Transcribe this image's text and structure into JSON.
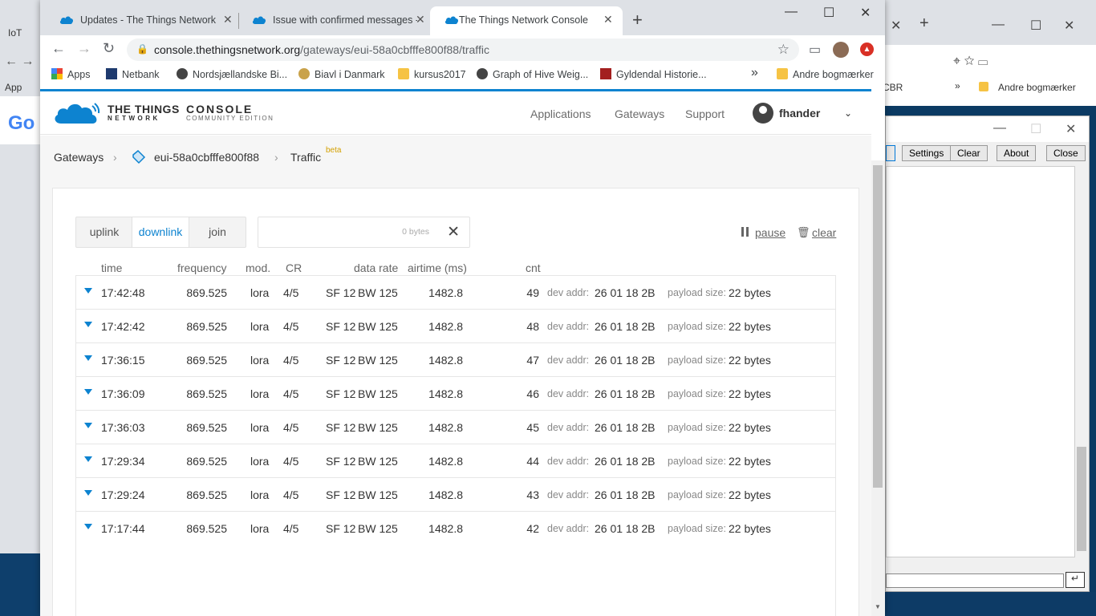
{
  "background": {
    "left_tab": "IoT",
    "left_apps": "App",
    "right_bookmark": "Andre bogmærker",
    "right_partial": "CBR",
    "debug_buttons": [
      "Settings",
      "Clear",
      "About",
      "Close"
    ]
  },
  "browser": {
    "tabs": [
      {
        "title": "Updates - The Things Network",
        "active": false
      },
      {
        "title": "Issue with confirmed messages -",
        "active": false
      },
      {
        "title": "The Things Network Console",
        "active": true
      }
    ],
    "url_host": "console.thethingsnetwork.org",
    "url_path": "/gateways/eui-58a0cbfffe800f88/traffic",
    "bookmarks": [
      "Apps",
      "Netbank",
      "Nordsjællandske Bi...",
      "Biavl i Danmark",
      "kursus2017",
      "Graph of Hive Weig...",
      "Gyldendal Historie..."
    ],
    "other_bookmarks": "Andre bogmærker"
  },
  "header": {
    "logo_line1": "THE THINGS",
    "logo_line2": "NETWORK",
    "console_line1": "CONSOLE",
    "console_line2": "COMMUNITY EDITION",
    "nav": [
      "Applications",
      "Gateways",
      "Support"
    ],
    "user": "fhander"
  },
  "breadcrumb": {
    "root": "Gateways",
    "gateway": "eui-58a0cbfffe800f88",
    "page": "Traffic",
    "badge": "beta"
  },
  "controls": {
    "tabs": [
      "uplink",
      "downlink",
      "join"
    ],
    "active_tab": "downlink",
    "filter_bytes": "0 bytes",
    "pause": "pause",
    "clear": "clear"
  },
  "table": {
    "columns": [
      "time",
      "frequency",
      "mod.",
      "CR",
      "data rate",
      "airtime (ms)",
      "cnt"
    ],
    "dev_addr_label": "dev addr:",
    "payload_label": "payload size:",
    "rows": [
      {
        "time": "17:42:48",
        "freq": "869.525",
        "mod": "lora",
        "cr": "4/5",
        "sf": "SF 12",
        "bw": "BW 125",
        "airtime": "1482.8",
        "cnt": "49",
        "addr": "26 01 18 2B",
        "payload": "22 bytes"
      },
      {
        "time": "17:42:42",
        "freq": "869.525",
        "mod": "lora",
        "cr": "4/5",
        "sf": "SF 12",
        "bw": "BW 125",
        "airtime": "1482.8",
        "cnt": "48",
        "addr": "26 01 18 2B",
        "payload": "22 bytes"
      },
      {
        "time": "17:36:15",
        "freq": "869.525",
        "mod": "lora",
        "cr": "4/5",
        "sf": "SF 12",
        "bw": "BW 125",
        "airtime": "1482.8",
        "cnt": "47",
        "addr": "26 01 18 2B",
        "payload": "22 bytes"
      },
      {
        "time": "17:36:09",
        "freq": "869.525",
        "mod": "lora",
        "cr": "4/5",
        "sf": "SF 12",
        "bw": "BW 125",
        "airtime": "1482.8",
        "cnt": "46",
        "addr": "26 01 18 2B",
        "payload": "22 bytes"
      },
      {
        "time": "17:36:03",
        "freq": "869.525",
        "mod": "lora",
        "cr": "4/5",
        "sf": "SF 12",
        "bw": "BW 125",
        "airtime": "1482.8",
        "cnt": "45",
        "addr": "26 01 18 2B",
        "payload": "22 bytes"
      },
      {
        "time": "17:29:34",
        "freq": "869.525",
        "mod": "lora",
        "cr": "4/5",
        "sf": "SF 12",
        "bw": "BW 125",
        "airtime": "1482.8",
        "cnt": "44",
        "addr": "26 01 18 2B",
        "payload": "22 bytes"
      },
      {
        "time": "17:29:24",
        "freq": "869.525",
        "mod": "lora",
        "cr": "4/5",
        "sf": "SF 12",
        "bw": "BW 125",
        "airtime": "1482.8",
        "cnt": "43",
        "addr": "26 01 18 2B",
        "payload": "22 bytes"
      },
      {
        "time": "17:17:44",
        "freq": "869.525",
        "mod": "lora",
        "cr": "4/5",
        "sf": "SF 12",
        "bw": "BW 125",
        "airtime": "1482.8",
        "cnt": "42",
        "addr": "26 01 18 2B",
        "payload": "22 bytes"
      }
    ]
  },
  "colors": {
    "accent": "#0d83d0",
    "beta": "#d4a000"
  }
}
